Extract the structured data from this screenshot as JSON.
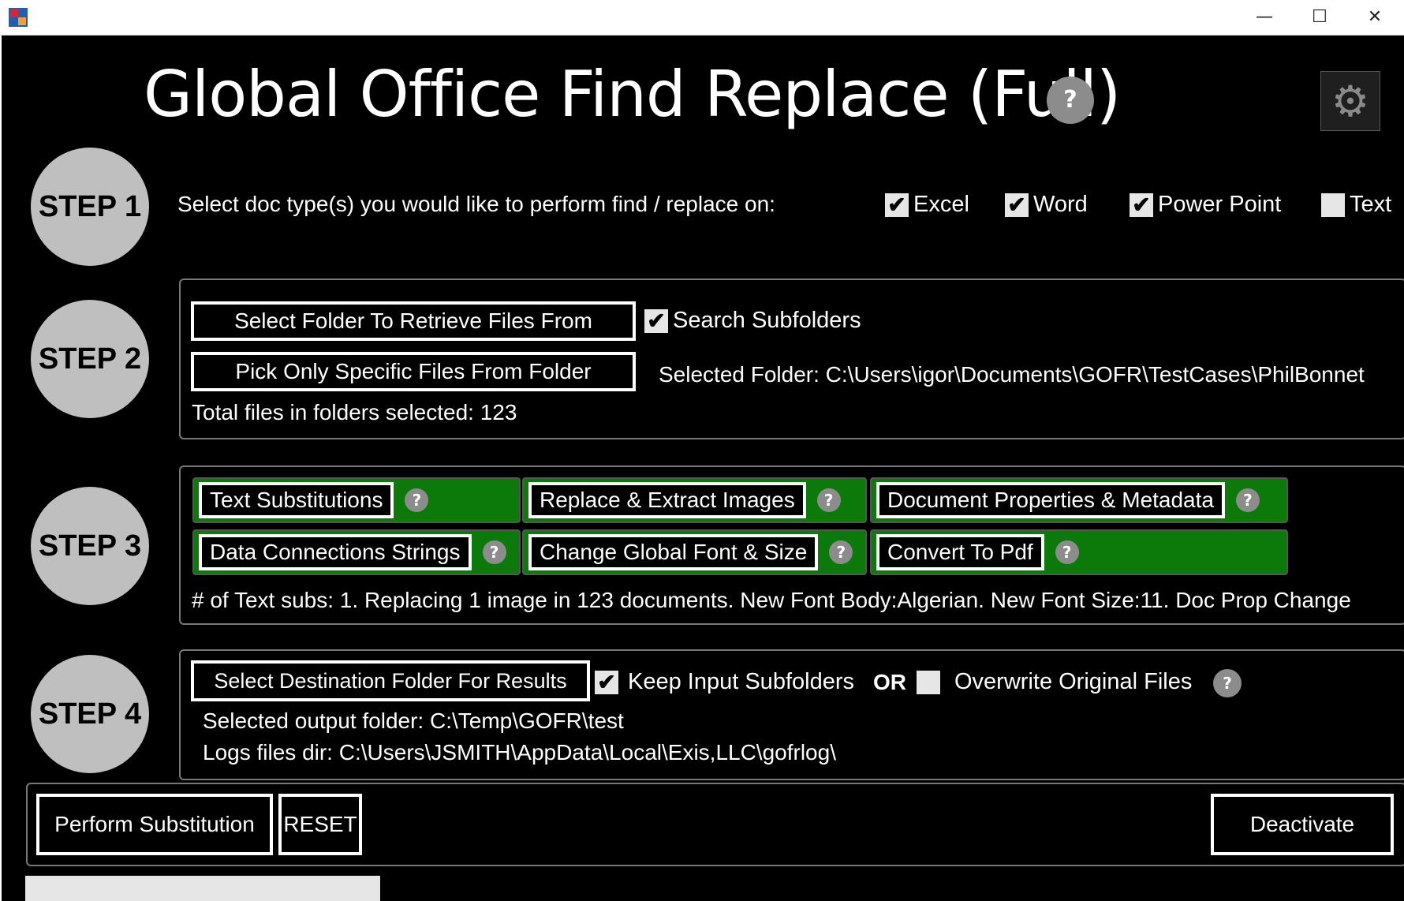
{
  "window": {
    "minimize": "—",
    "maximize": "☐",
    "close": "✕"
  },
  "header": {
    "title": "Global Office Find Replace (Full)",
    "help": "?"
  },
  "step1": {
    "label": "STEP 1",
    "prompt": "Select doc type(s) you would like to perform find / replace on:",
    "options": [
      {
        "label": "Excel",
        "checked": true
      },
      {
        "label": "Word",
        "checked": true
      },
      {
        "label": "Power Point",
        "checked": true
      },
      {
        "label": "Text",
        "checked": false
      }
    ]
  },
  "step2": {
    "label": "STEP 2",
    "select_folder": "Select Folder To Retrieve Files From",
    "search_subfolders": "Search Subfolders",
    "pick_files": "Pick Only Specific Files From Folder",
    "selected_folder": "Selected Folder: C:\\Users\\igor\\Documents\\GOFR\\TestCases\\PhilBonnet",
    "total_files": "Total files in folders selected: 123"
  },
  "step3": {
    "label": "STEP 3",
    "text_subs": "Text Substitutions",
    "replace_images": "Replace & Extract Images",
    "doc_props": "Document Properties & Metadata",
    "data_conn": "Data Connections Strings",
    "global_font": "Change Global Font & Size",
    "convert_pdf": "Convert To Pdf",
    "summary": "# of Text subs: 1. Replacing 1 image in 123 documents. New Font Body:Algerian. New Font Size:11. Doc Prop Change"
  },
  "step4": {
    "label": "STEP 4",
    "select_dest": "Select Destination Folder For Results",
    "keep_subfolders": "Keep Input Subfolders",
    "or": "OR",
    "overwrite": "Overwrite Original Files",
    "output_folder": "Selected output folder: C:\\Temp\\GOFR\\test",
    "logs_dir": "Logs files dir: C:\\Users\\JSMITH\\AppData\\Local\\Exis,LLC\\gofrlog\\"
  },
  "actions": {
    "perform": "Perform Substitution",
    "reset": "RESET",
    "deactivate": "Deactivate"
  },
  "checkmark": "✔"
}
